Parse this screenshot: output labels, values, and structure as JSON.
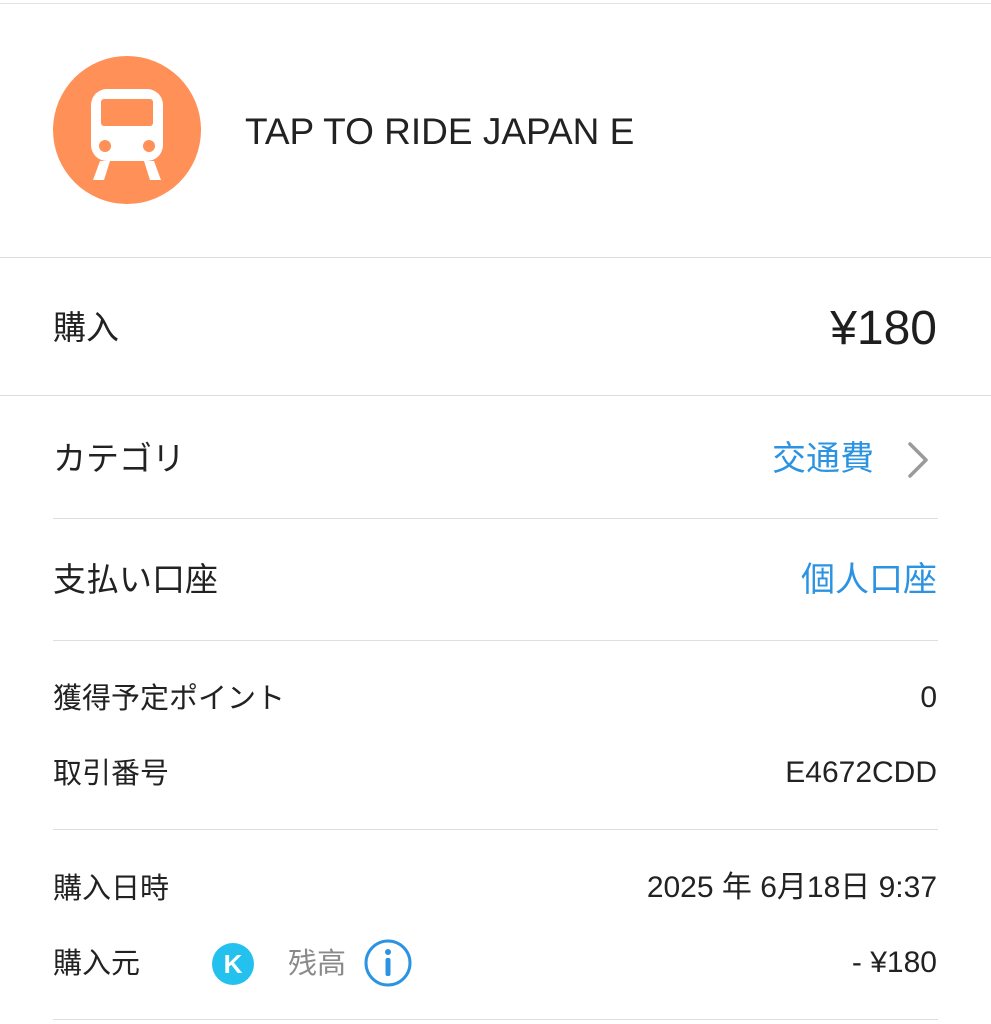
{
  "merchant": {
    "icon": "train-icon",
    "name": "TAP TO RIDE JAPAN E",
    "avatar_color": "#ff9057"
  },
  "purchase": {
    "label": "購入",
    "amount": "¥180"
  },
  "category": {
    "label": "カテゴリ",
    "value": "交通費",
    "link_color": "#2b93e2"
  },
  "payment_account": {
    "label": "支払い口座",
    "value": "個人口座"
  },
  "details": {
    "points_label": "獲得予定ポイント",
    "points_value": "0",
    "transaction_id_label": "取引番号",
    "transaction_id_value": "E4672CDD"
  },
  "purchase_info": {
    "datetime_label": "購入日時",
    "datetime_value": "2025 年 6月18日  9:37",
    "source_label": "購入元",
    "source_badge": "K",
    "source_badge_color": "#24c0ee",
    "source_method": "残高",
    "source_amount": "- ¥180"
  }
}
